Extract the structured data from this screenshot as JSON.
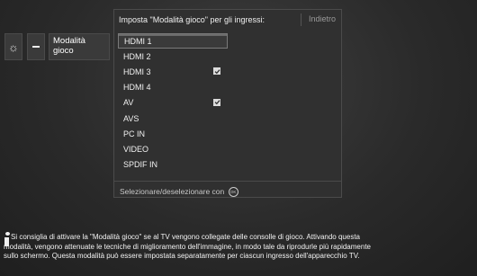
{
  "sidebar": {
    "gear_icon": "gear-icon",
    "dots_icon": "more-icon",
    "label_line1": "Modalità",
    "label_line2": "gioco"
  },
  "panel": {
    "title": "Imposta \"Modalità gioco\" per gli ingressi:",
    "back_label": "Indietro",
    "inputs": [
      {
        "label": "HDMI 1",
        "checked": false,
        "selected": true
      },
      {
        "label": "HDMI 2",
        "checked": false,
        "selected": false
      },
      {
        "label": "HDMI 3",
        "checked": true,
        "selected": false
      },
      {
        "label": "HDMI 4",
        "checked": false,
        "selected": false
      },
      {
        "label": "AV",
        "checked": true,
        "selected": false
      },
      {
        "label": "AVS",
        "checked": false,
        "selected": false
      },
      {
        "label": "PC IN",
        "checked": false,
        "selected": false
      },
      {
        "label": "VIDEO",
        "checked": false,
        "selected": false
      },
      {
        "label": "SPDIF IN",
        "checked": false,
        "selected": false
      }
    ],
    "footer_text": "Selezionare/deselezionare con",
    "footer_button_icon": "ok-button-icon",
    "footer_button_label": "OK"
  },
  "info": {
    "icon": "info-icon",
    "line1": "Si consiglia di attivare la \"Modalità gioco\" se al TV vengono collegate delle consolle di gioco. Attivando questa",
    "line2": "modalità, vengono attenuate le tecniche di miglioramento dell'immagine, in modo tale da riprodurle più rapidamente",
    "line3": "sullo schermo. Questa modalità può essere impostata separatamente per ciascun ingresso dell'apparecchio TV."
  }
}
